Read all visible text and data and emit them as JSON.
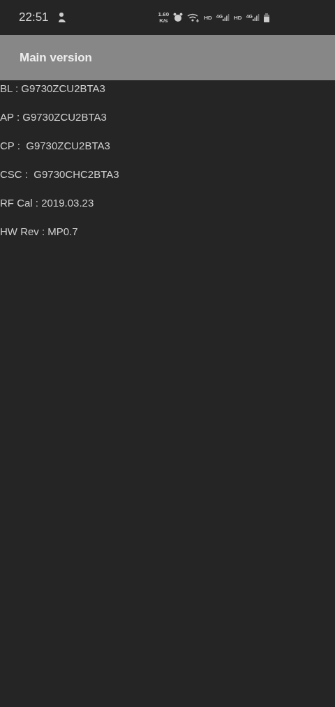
{
  "status_bar": {
    "time": "22:51",
    "speed_value": "1.60",
    "speed_unit": "K/s",
    "sims": [
      {
        "hd": "HD",
        "network": "4G"
      },
      {
        "hd": "HD",
        "network": "4G"
      }
    ]
  },
  "app_bar": {
    "title": "Main version"
  },
  "lines": [
    "BL : G9730ZCU2BTA3",
    "AP : G9730ZCU2BTA3",
    "CP :  G9730ZCU2BTA3",
    "CSC :  G9730CHC2BTA3",
    "RF Cal : 2019.03.23",
    "HW Rev : MP0.7"
  ]
}
